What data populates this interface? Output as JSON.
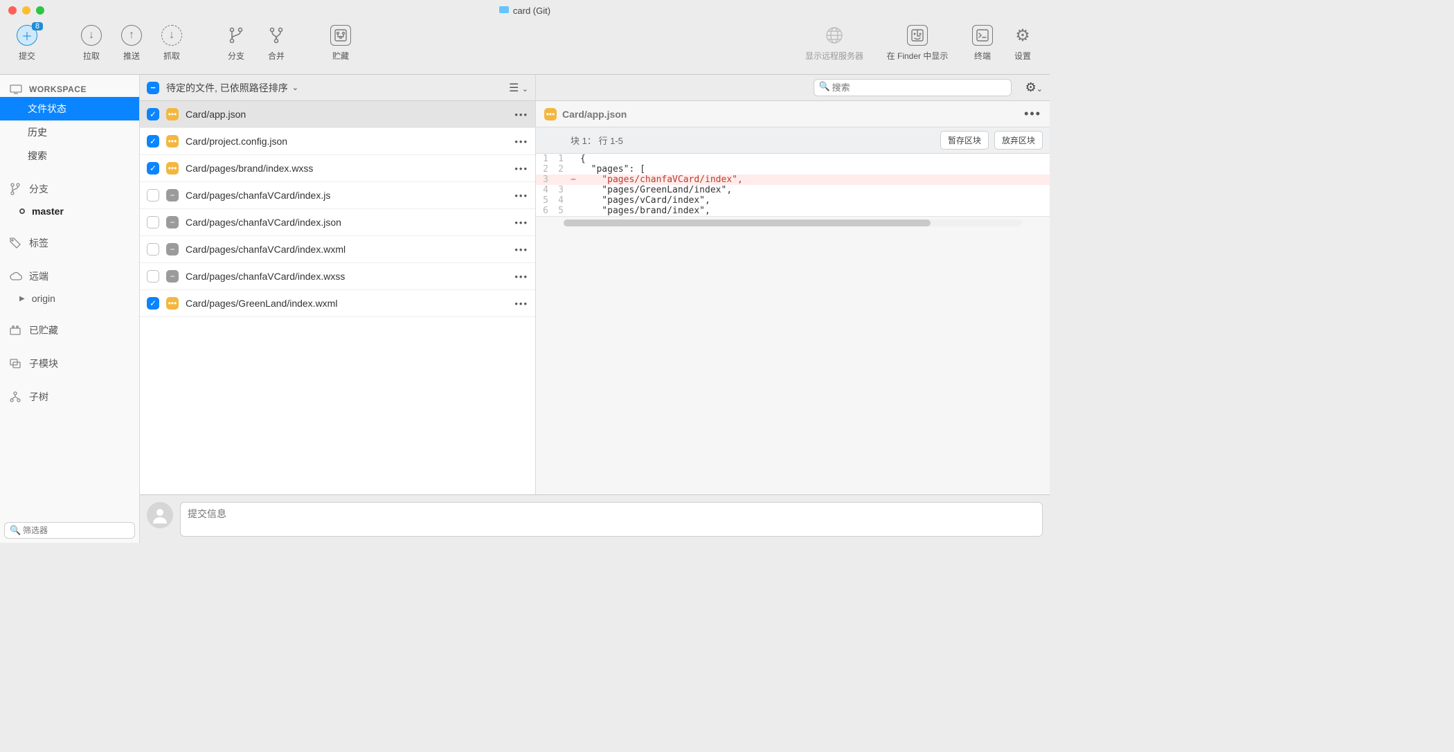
{
  "window": {
    "title": "card (Git)"
  },
  "toolbar": {
    "commit": "提交",
    "commit_badge": "8",
    "pull": "拉取",
    "push": "推送",
    "fetch": "抓取",
    "branch": "分支",
    "merge": "合并",
    "stash": "贮藏",
    "remote_show": "显示远程服务器",
    "show_finder": "在 Finder 中显示",
    "terminal": "终端",
    "settings": "设置"
  },
  "sidebar": {
    "workspace_label": "WORKSPACE",
    "workspace": {
      "file_status": "文件状态",
      "history": "历史",
      "search": "搜索"
    },
    "branch_label": "分支",
    "branches": [
      "master"
    ],
    "tag_label": "标签",
    "remote_label": "远端",
    "remotes": [
      "origin"
    ],
    "stash_label": "已贮藏",
    "submodule_label": "子模块",
    "subtree_label": "子树",
    "filter_placeholder": "筛选器"
  },
  "filelist": {
    "header_label": "待定的文件, 已依照路径排序",
    "files": [
      {
        "checked": true,
        "status": "mod",
        "name": "Card/app.json"
      },
      {
        "checked": true,
        "status": "mod",
        "name": "Card/project.config.json"
      },
      {
        "checked": true,
        "status": "mod",
        "name": "Card/pages/brand/index.wxss"
      },
      {
        "checked": false,
        "status": "del",
        "name": "Card/pages/chanfaVCard/index.js"
      },
      {
        "checked": false,
        "status": "del",
        "name": "Card/pages/chanfaVCard/index.json"
      },
      {
        "checked": false,
        "status": "del",
        "name": "Card/pages/chanfaVCard/index.wxml"
      },
      {
        "checked": false,
        "status": "del",
        "name": "Card/pages/chanfaVCard/index.wxss"
      },
      {
        "checked": true,
        "status": "mod",
        "name": "Card/pages/GreenLand/index.wxml"
      }
    ]
  },
  "diff": {
    "search_placeholder": "搜索",
    "filename": "Card/app.json",
    "hunk_label": "块 1：  行 1-5",
    "stage_label": "暂存区块",
    "discard_label": "放弃区块",
    "lines": [
      {
        "old": "1",
        "new": "1",
        "mark": " ",
        "text": "{"
      },
      {
        "old": "2",
        "new": "2",
        "mark": " ",
        "text": "  \"pages\": ["
      },
      {
        "old": "3",
        "new": "",
        "mark": "-",
        "text": "    \"pages/chanfaVCard/index\","
      },
      {
        "old": "4",
        "new": "3",
        "mark": " ",
        "text": "    \"pages/GreenLand/index\","
      },
      {
        "old": "5",
        "new": "4",
        "mark": " ",
        "text": "    \"pages/vCard/index\","
      },
      {
        "old": "6",
        "new": "5",
        "mark": " ",
        "text": "    \"pages/brand/index\","
      }
    ]
  },
  "commit": {
    "placeholder": "提交信息"
  }
}
